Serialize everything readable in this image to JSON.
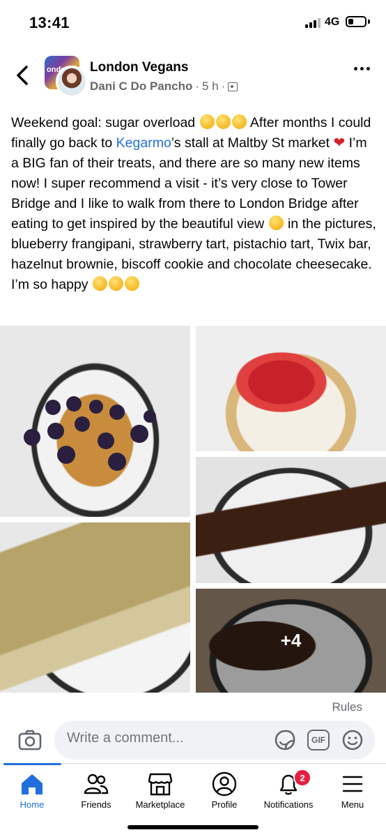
{
  "status_bar": {
    "time": "13:41",
    "network": "4G"
  },
  "header": {
    "group_name": "London Vegans",
    "author": "Dani C Do Pancho",
    "time_ago": "5 h",
    "separator": "·"
  },
  "post": {
    "text_1": "Weekend goal: sugar overload ",
    "text_2": " After months I could finally go back to ",
    "link": "Kegarmo",
    "text_3": "’s stall at Maltby St market ",
    "text_4": " I’m a BIG fan of their treats, and there are so many new items now! I super recommend a visit - it’s very close to Tower Bridge and I like to walk from there to London Bridge after eating to get inspired by the beautiful view ",
    "text_5": "  in the pictures, blueberry frangipani, strawberry tart, pistachio tart, Twix bar, hazelnut brownie, biscoff cookie and chocolate cheesecake. I’m so happy ",
    "heart": "❤"
  },
  "photos": {
    "more_count": "+4",
    "items": [
      "blueberry frangipani",
      "strawberry tart",
      "twix bar",
      "pistachio tart",
      "hazelnut brownie"
    ]
  },
  "rules_label": "Rules",
  "comment": {
    "placeholder": "Write a comment...",
    "gif_label": "GIF"
  },
  "nav": {
    "home": "Home",
    "friends": "Friends",
    "marketplace": "Marketplace",
    "profile": "Profile",
    "notifications": "Notifications",
    "menu": "Menu",
    "notifications_badge": "2"
  },
  "colors": {
    "accent": "#216fdb",
    "badge": "#e41e3f",
    "secondary_text": "#65676b"
  }
}
